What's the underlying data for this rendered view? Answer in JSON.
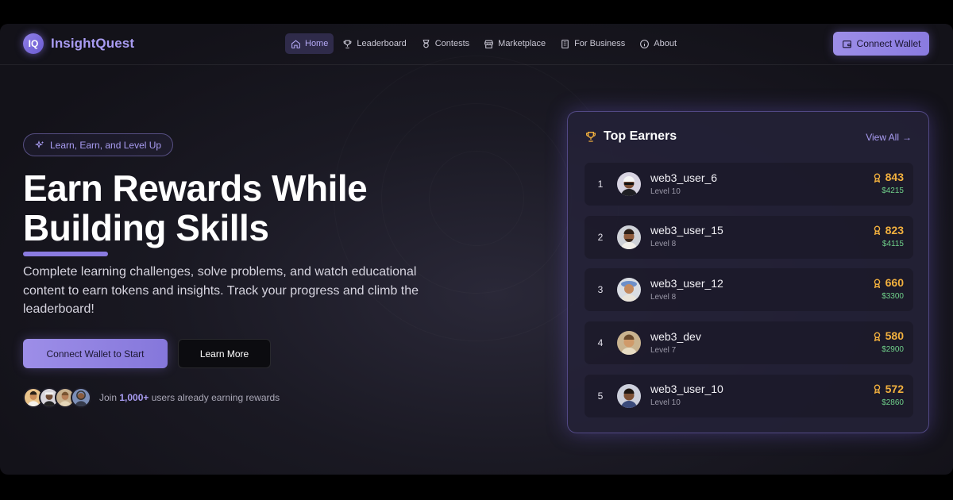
{
  "brand": {
    "logo_text": "IQ",
    "name": "InsightQuest",
    "accent": "#a99cf2"
  },
  "nav": {
    "items": [
      {
        "label": "Home",
        "icon": "home-icon",
        "active": true
      },
      {
        "label": "Leaderboard",
        "icon": "trophy-icon",
        "active": false
      },
      {
        "label": "Contests",
        "icon": "award-icon",
        "active": false
      },
      {
        "label": "Marketplace",
        "icon": "store-icon",
        "active": false
      },
      {
        "label": "For Business",
        "icon": "building-icon",
        "active": false
      },
      {
        "label": "About",
        "icon": "info-icon",
        "active": false
      }
    ],
    "connect_label": "Connect Wallet"
  },
  "hero": {
    "tagline": "Learn, Earn, and Level Up",
    "headline_line1": "Earn Rewards While",
    "headline_line2": "Building Skills",
    "subtext": "Complete learning challenges, solve problems, and watch educational content to earn tokens and insights. Track your progress and climb the leaderboard!",
    "primary_cta": "Connect Wallet to Start",
    "secondary_cta": "Learn More",
    "social_prefix": "Join",
    "social_count": "1,000+",
    "social_suffix": "users already earning rewards"
  },
  "leaderboard": {
    "title": "Top Earners",
    "view_all": "View All",
    "entries": [
      {
        "rank": "1",
        "username": "web3_user_6",
        "level": "Level 10",
        "points": "843",
        "usd": "$4215"
      },
      {
        "rank": "2",
        "username": "web3_user_15",
        "level": "Level 8",
        "points": "823",
        "usd": "$4115"
      },
      {
        "rank": "3",
        "username": "web3_user_12",
        "level": "Level 8",
        "points": "660",
        "usd": "$3300"
      },
      {
        "rank": "4",
        "username": "web3_dev",
        "level": "Level 7",
        "points": "580",
        "usd": "$2900"
      },
      {
        "rank": "5",
        "username": "web3_user_10",
        "level": "Level 10",
        "points": "572",
        "usd": "$2860"
      }
    ]
  },
  "colors": {
    "points": "#f3b13e",
    "usd": "#6fd08a",
    "primary": "#8a7be0"
  }
}
